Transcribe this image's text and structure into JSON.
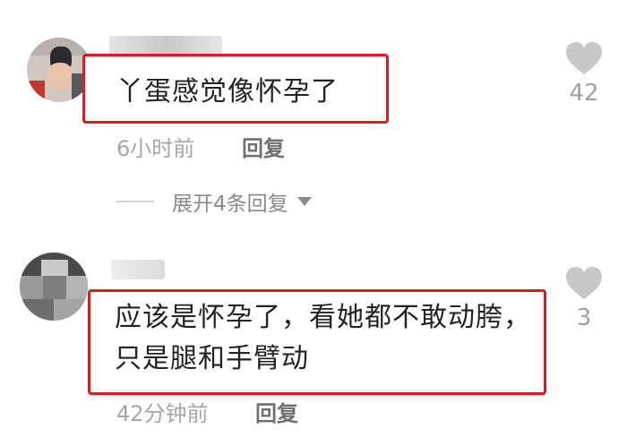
{
  "comments": [
    {
      "content": "丫蛋感觉像怀孕了",
      "time": "6小时前",
      "reply_label": "回复",
      "like_count": "42",
      "expand_label": "展开4条回复"
    },
    {
      "content": "应该是怀孕了，看她都不敢动胯，只是腿和手臂动",
      "time": "42分钟前",
      "reply_label": "回复",
      "like_count": "3"
    }
  ],
  "icons": {
    "like": "heart-icon",
    "expand": "triangle-down-icon"
  },
  "colors": {
    "highlight_border": "#e0191a",
    "secondary_text": "#a6a6a6",
    "icon_gray": "#c8c8c8"
  }
}
